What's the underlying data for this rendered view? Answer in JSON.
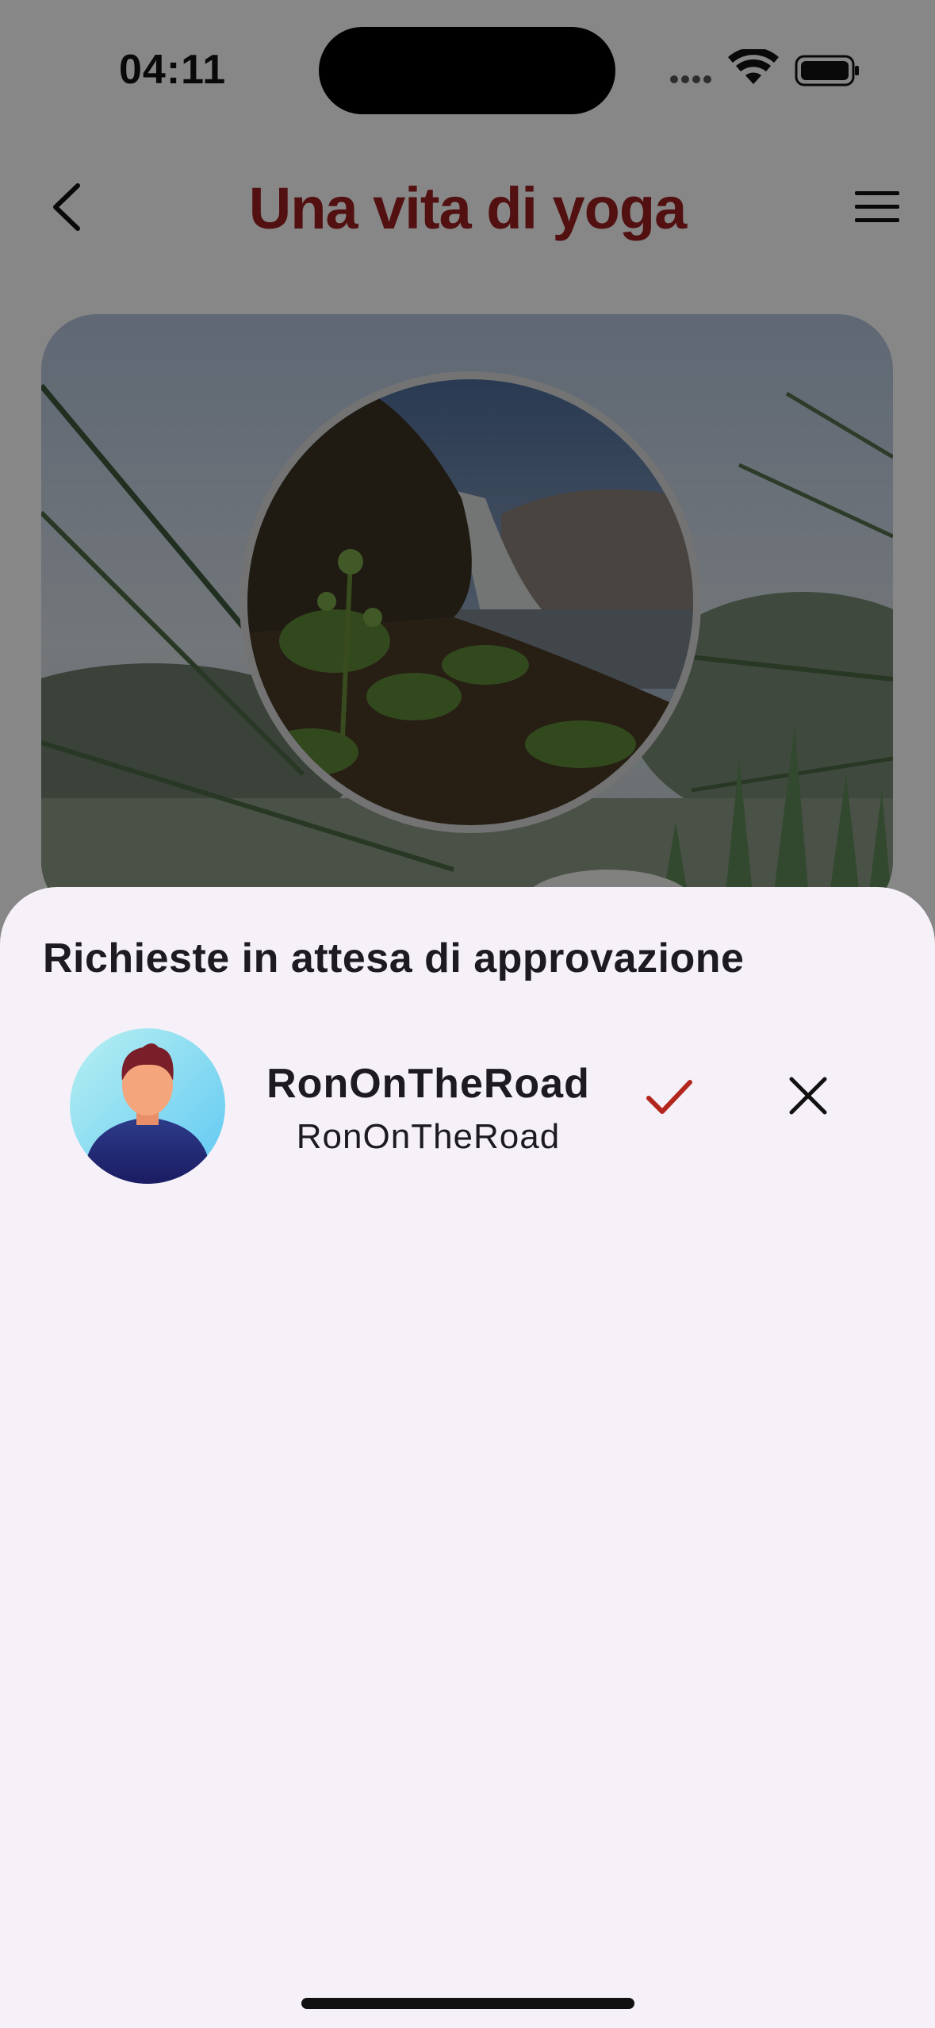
{
  "status_bar": {
    "time": "04:11"
  },
  "header": {
    "title": "Una vita di yoga"
  },
  "sheet": {
    "title": "Richieste in attesa di approvazione",
    "requests": [
      {
        "display_name": "RonOnTheRoad",
        "username": "RonOnTheRoad"
      }
    ]
  },
  "colors": {
    "accent": "#9c1f1f",
    "sheet_bg": "#f6f1f8",
    "text": "#1d1b20"
  },
  "icons": [
    "back-chevron-icon",
    "hamburger-menu-icon",
    "checkmark-icon",
    "close-icon",
    "wifi-icon",
    "battery-icon",
    "signal-icon"
  ]
}
